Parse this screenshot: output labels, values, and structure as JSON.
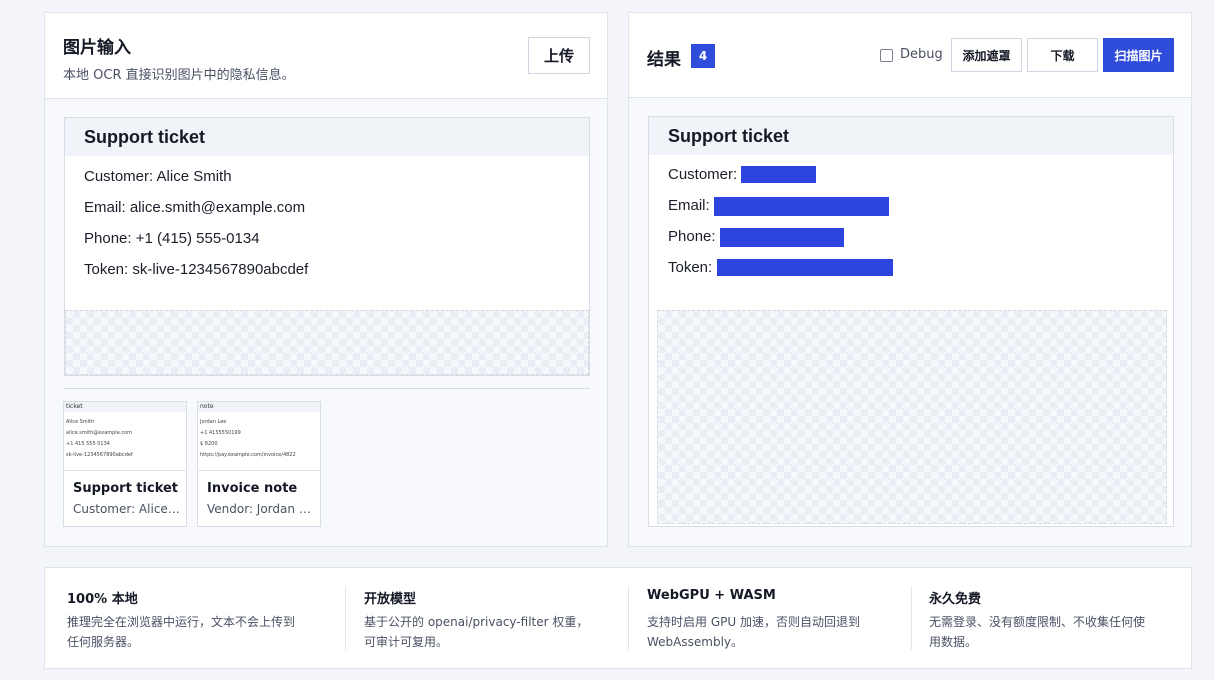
{
  "input_panel": {
    "title": "图片输入",
    "subtitle": "本地 OCR 直接识别图片中的隐私信息。",
    "upload_label": "上传"
  },
  "result_panel": {
    "title": "结果",
    "count": "4",
    "debug_label": "Debug",
    "debug_checked": false,
    "add_mask_label": "添加遮罩",
    "download_label": "下载",
    "scan_label": "扫描图片"
  },
  "document": {
    "title": "Support ticket",
    "lines": [
      "Customer: Alice Smith",
      "Email: alice.smith@example.com",
      "Phone: +1 (415) 555-0134",
      "Token: sk-live-1234567890abcdef"
    ],
    "redacted_labels": [
      "Customer:",
      "Email:",
      "Phone:",
      "Token:"
    ]
  },
  "samples": [
    {
      "title": "Support ticket",
      "subtitle": "Customer: Alice Smith",
      "preview_title": "ticket",
      "preview_lines": [
        "Alice Smith",
        "alice.smith@example.com",
        "+1 415 555 0134",
        "sk-live-1234567890abcdef"
      ]
    },
    {
      "title": "Invoice note",
      "subtitle": "Vendor: Jordan Lee",
      "preview_title": "note",
      "preview_lines": [
        "Jordan Lee",
        "+1 4155550199",
        "$ 8200",
        "https://pay.example.com/invoice/4822"
      ]
    }
  ],
  "features": [
    {
      "title": "100% 本地",
      "desc": [
        "推理完全在浏览器中运行，文本不会上传到",
        "任何服务器。"
      ]
    },
    {
      "title": "开放模型",
      "desc": [
        "基于公开的 openai/privacy-filter 权重，",
        "可审计可复用。"
      ]
    },
    {
      "title": "WebGPU + WASM",
      "desc": [
        "支持时启用 GPU 加速，否则自动回退到",
        "WebAssembly。"
      ]
    },
    {
      "title": "永久免费",
      "desc": [
        "无需登录、没有额度限制、不收集任何使",
        "用数据。"
      ]
    }
  ],
  "colors": {
    "accent": "#2f4cdb",
    "redaction": "#2d44df",
    "background": "#f3f5fa"
  }
}
